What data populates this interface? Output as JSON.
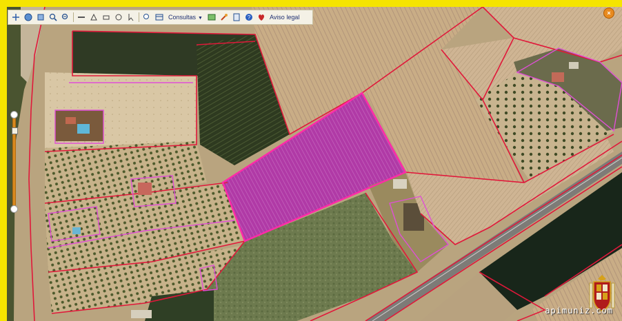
{
  "toolbar": {
    "consultas_label": "Consultas",
    "aviso_label": "Aviso legal",
    "icons": [
      "pan-icon",
      "globe-icon",
      "layers-icon",
      "zoom-in-icon",
      "zoom-out-icon",
      "measure-icon",
      "area-icon",
      "print-icon",
      "info-icon",
      "select-icon",
      "search-icon",
      "consultas-menu",
      "map-icon",
      "tools-icon",
      "page-icon",
      "help-icon",
      "legal-icon"
    ]
  },
  "watermark": {
    "text": "apimuniz.com"
  },
  "colors": {
    "frame": "#f5e400",
    "parcel_border": "#e0183a",
    "highlight_fill": "#c42ab0",
    "subparcel": "#e04fd6"
  }
}
